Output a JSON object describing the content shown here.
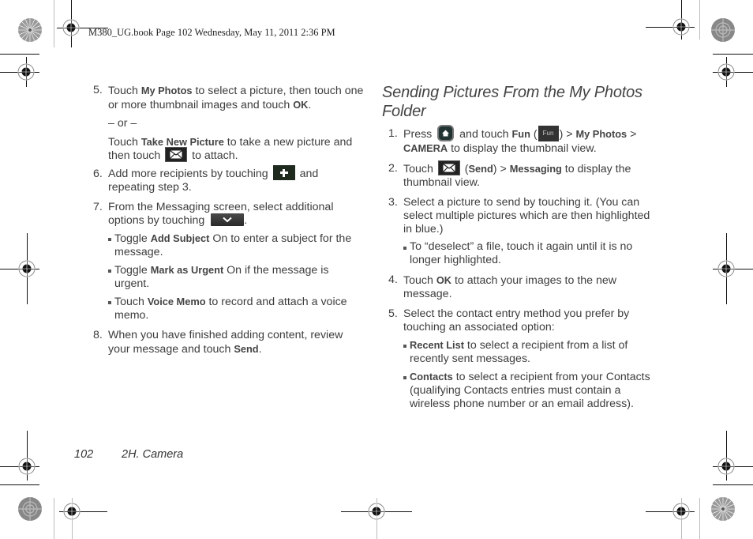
{
  "header": {
    "print_info": "M380_UG.book  Page 102  Wednesday, May 11, 2011  2:36 PM"
  },
  "left_column": {
    "step5": {
      "num": "5.",
      "t1": "Touch ",
      "b1": "My Photos",
      "t2": " to select a picture, then touch one or more thumbnail images and touch ",
      "b2": "OK",
      "t3": ".",
      "or": "– or –",
      "t4": "Touch ",
      "b3": "Take New Picture",
      "t5": " to take a new picture and then touch ",
      "t6": " to attach."
    },
    "step6": {
      "num": "6.",
      "t1": "Add more recipients by touching ",
      "t2": " and repeating step 3."
    },
    "step7": {
      "num": "7.",
      "t1": "From the Messaging screen, select additional options by touching ",
      "t2": ".",
      "bullets": [
        {
          "pre": "Toggle ",
          "bold": "Add Subject",
          "post": " On to enter a subject for the message."
        },
        {
          "pre": "Toggle ",
          "bold": "Mark as Urgent",
          "post": " On if the message is urgent."
        },
        {
          "pre": "Touch ",
          "bold": "Voice Memo",
          "post": " to record and attach a voice memo."
        }
      ]
    },
    "step8": {
      "num": "8.",
      "t1": "When you have finished adding content, review your message and touch ",
      "b1": "Send",
      "t2": "."
    }
  },
  "right_column": {
    "heading": "Sending Pictures From the My Photos Folder",
    "step1": {
      "num": "1.",
      "t1": "Press ",
      "t2": " and touch ",
      "b1": "Fun",
      "t3": " (",
      "fun_label": "Fun",
      "t4": ") > ",
      "b2": "My Photos",
      "t5": " > ",
      "b3": "CAMERA",
      "t6": " to display the thumbnail view."
    },
    "step2": {
      "num": "2.",
      "t1": "Touch ",
      "t2": " (",
      "b1": "Send",
      "t3": ") > ",
      "b2": "Messaging",
      "t4": " to display the thumbnail view."
    },
    "step3": {
      "num": "3.",
      "t1": "Select a picture to send by touching it. (You can select multiple pictures which are then highlighted in blue.)",
      "bullets": [
        {
          "pre": "To “deselect” a file, touch it again until it is no longer highlighted.",
          "bold": "",
          "post": ""
        }
      ]
    },
    "step4": {
      "num": "4.",
      "t1": "Touch ",
      "b1": "OK",
      "t2": " to attach your images to the new message."
    },
    "step5": {
      "num": "5.",
      "t1": "Select the contact entry method you prefer by touching an associated option:",
      "bullets": [
        {
          "pre": "",
          "bold": "Recent List",
          "post": " to select a recipient from a list of recently sent messages."
        },
        {
          "pre": "",
          "bold": "Contacts",
          "post": " to select a recipient from your Contacts (qualifying Contacts entries must contain a wireless phone number or an email address)."
        }
      ]
    }
  },
  "footer": {
    "page_number": "102",
    "section": "2H. Camera"
  },
  "icons": {
    "envelope": "envelope-icon",
    "plus": "plus-icon",
    "chevron": "chevron-down-icon",
    "home": "home-icon",
    "fun": "fun-icon"
  }
}
